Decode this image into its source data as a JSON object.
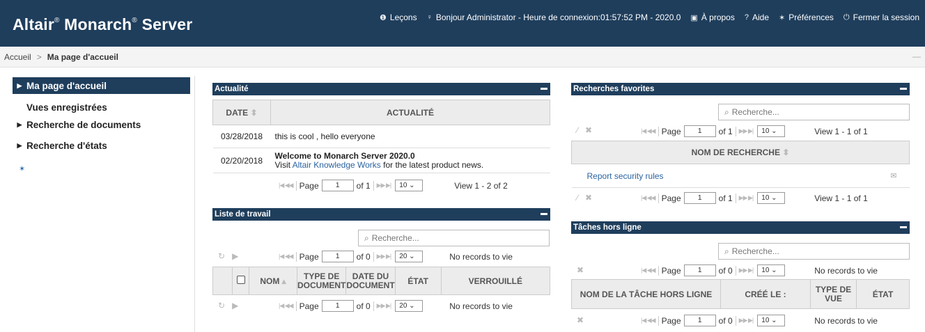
{
  "header": {
    "brand": "Altair",
    "brand2": "Monarch",
    "brand3": "Server",
    "reg": "®",
    "nav": {
      "lessons": "Leçons",
      "greeting": "Bonjour Administrator - Heure de connexion:01:57:52 PM - 2020.0",
      "about": "À propos",
      "help": "Aide",
      "prefs": "Préférences",
      "logout": "Fermer la session"
    }
  },
  "breadcrumb": {
    "home": "Accueil",
    "current": "Ma page d'accueil",
    "collapse": "—"
  },
  "sidebar": {
    "items": [
      {
        "label": "Ma page d'accueil"
      },
      {
        "label": "Vues enregistrées"
      },
      {
        "label": "Recherche de documents"
      },
      {
        "label": "Recherche d'états"
      }
    ],
    "collapse": "<"
  },
  "news": {
    "title": "Actualité",
    "col_date": "DATE",
    "col_news": "ACTUALITÉ",
    "rows": [
      {
        "date": "03/28/2018",
        "text": "this is cool , hello everyone"
      },
      {
        "date": "02/20/2018",
        "title": "Welcome to Monarch Server 2020.0",
        "pre": "Visit ",
        "link": "Altair Knowledge Works",
        "post": " for the latest product news."
      }
    ],
    "pager": {
      "page_label": "Page",
      "page": "1",
      "of": "of 1",
      "size": "10",
      "view": "View 1 - 2 of 2"
    }
  },
  "worklist": {
    "title": "Liste de travail",
    "search_placeholder": "Recherche...",
    "pager": {
      "page_label": "Page",
      "page": "1",
      "of": "of 0",
      "size": "20",
      "view": "No records to vie"
    },
    "cols": {
      "name": "NOM",
      "type1": "TYPE DE",
      "type2": "DOCUMENT",
      "date1": "DATE DU",
      "date2": "DOCUMENT",
      "state": "ÉTAT",
      "lock": "VERROUILLÉ"
    },
    "pager2": {
      "page_label": "Page",
      "page": "1",
      "of": "of 0",
      "size": "20",
      "view": "No records to vie"
    }
  },
  "favorites": {
    "title": "Recherches favorites",
    "search_placeholder": "Recherche...",
    "pager": {
      "page_label": "Page",
      "page": "1",
      "of": "of 1",
      "size": "10",
      "view": "View 1 - 1 of 1"
    },
    "col_name": "NOM DE RECHERCHE",
    "rows": [
      {
        "name": "Report security rules"
      }
    ],
    "pager2": {
      "page_label": "Page",
      "page": "1",
      "of": "of 1",
      "size": "10",
      "view": "View 1 - 1 of 1"
    }
  },
  "offline": {
    "title": "Tâches hors ligne",
    "search_placeholder": "Recherche...",
    "pager": {
      "page_label": "Page",
      "page": "1",
      "of": "of 0",
      "size": "10",
      "view": "No records to vie"
    },
    "cols": {
      "name": "NOM DE LA TÂCHE HORS LIGNE",
      "created": "CRÉÉ LE :",
      "type1": "TYPE DE",
      "type2": "VUE",
      "state": "ÉTAT"
    },
    "pager2": {
      "page_label": "Page",
      "page": "1",
      "of": "of 0",
      "size": "10",
      "view": "No records to vie"
    }
  }
}
